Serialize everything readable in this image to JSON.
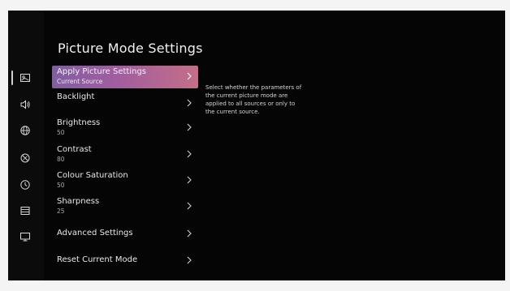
{
  "page": {
    "title": "Picture Mode Settings",
    "description": "Select whether the parameters of the current picture mode are applied to all sources or only to the current source."
  },
  "sidebar": {
    "items": [
      {
        "icon": "picture-icon",
        "active": true
      },
      {
        "icon": "speaker-icon",
        "active": false
      },
      {
        "icon": "globe-icon",
        "active": false
      },
      {
        "icon": "satellite-icon",
        "active": false
      },
      {
        "icon": "clock-icon",
        "active": false
      },
      {
        "icon": "list-icon",
        "active": false
      },
      {
        "icon": "tv-icon",
        "active": false
      }
    ]
  },
  "menu": {
    "items": [
      {
        "label": "Apply Picture Settings",
        "value": "Current Source",
        "selected": true
      },
      {
        "label": "Backlight",
        "value": "",
        "selected": false
      },
      {
        "label": "Brightness",
        "value": "50",
        "selected": false
      },
      {
        "label": "Contrast",
        "value": "80",
        "selected": false
      },
      {
        "label": "Colour Saturation",
        "value": "50",
        "selected": false
      },
      {
        "label": "Sharpness",
        "value": "25",
        "selected": false
      },
      {
        "label": "Advanced Settings",
        "value": "",
        "selected": false
      },
      {
        "label": "Reset Current Mode",
        "value": "",
        "selected": false
      }
    ]
  },
  "colors": {
    "accent_start": "#7f5fa1",
    "accent_end": "#c46f88",
    "background": "#050505"
  }
}
